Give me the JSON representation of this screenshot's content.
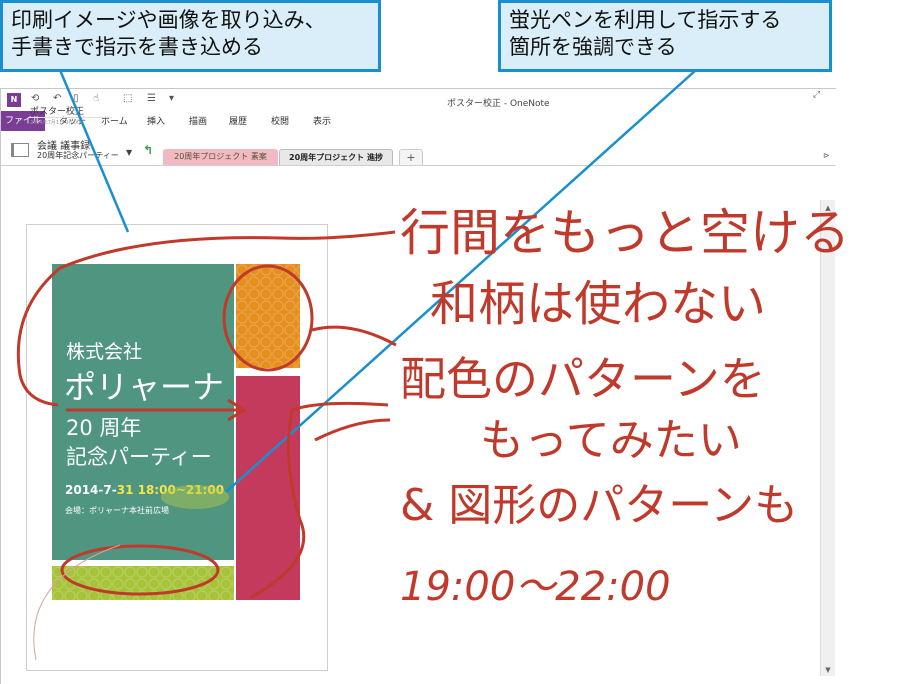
{
  "callouts": {
    "left_line1": "印刷イメージや画像を取り込み、",
    "left_line2": "手書きで指示を書き込める",
    "right_line1": "蛍光ペンを利用して指示する",
    "right_line2": "箇所を強調できる"
  },
  "window": {
    "title": "ポスター校正 - OneNote",
    "app_icon": "N"
  },
  "ribbon": {
    "tabs": [
      "ファイル",
      "タッチ",
      "ホーム",
      "挿入",
      "描画",
      "履歴",
      "校閲",
      "表示"
    ]
  },
  "notebook": {
    "name": "会議 議事録",
    "section": "20周年記念パーティー",
    "dropdown": "▼",
    "back": "↰",
    "section_tabs": [
      "20周年プロジェクト 素案",
      "20周年プロジェクト 進捗"
    ],
    "add_tab": "+"
  },
  "page": {
    "title": "ポスター校正",
    "date": "2014年7月1日 10:00"
  },
  "poster": {
    "company": "株式会社",
    "name": "ポリャーナ",
    "anniversary": "20 周年",
    "party": "記念パーティー",
    "date_prefix": "2014-7-",
    "date_highlight": "31 18:00~21:00",
    "venue": "会場：ポリャーナ本社前広場"
  },
  "ink_notes": {
    "line1": "行間をもっと空ける",
    "line2": "和柄は使わない",
    "line3": "配色のパターンを",
    "line4": "もってみたい",
    "line5": "& 図形のパターンも",
    "time": "19:00～22:00"
  },
  "colors": {
    "callout_border": "#1a8fd0",
    "callout_fill": "#d9eef8",
    "ink": "#c0392b",
    "poster_green": "#4f9580",
    "poster_orange": "#e48f1e",
    "poster_crimson": "#c33a5d",
    "poster_lime": "#a6c33a",
    "app_purple": "#7b3c96"
  }
}
